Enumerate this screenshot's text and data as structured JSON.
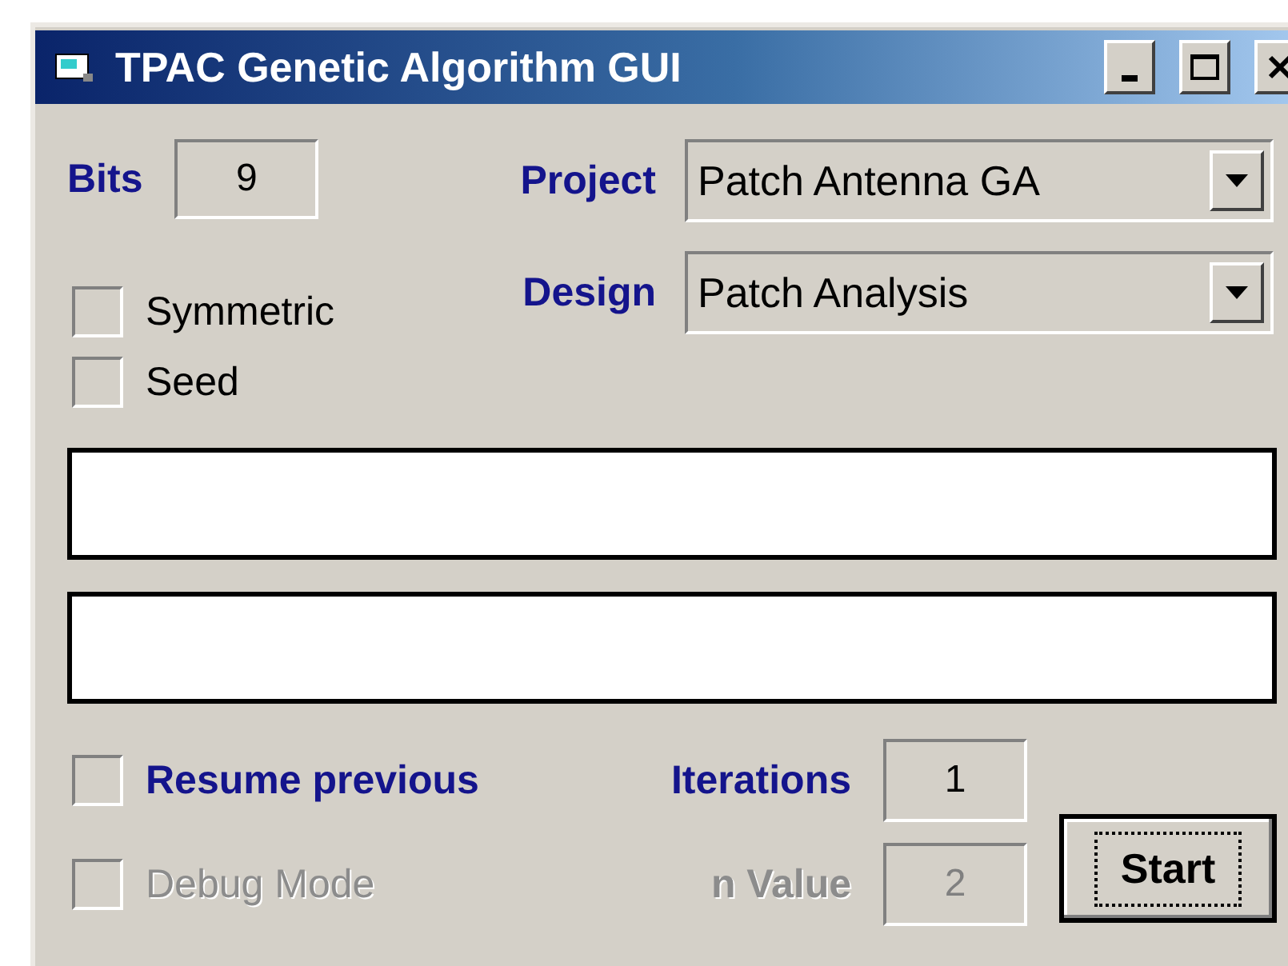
{
  "window": {
    "title": "TPAC Genetic Algorithm GUI"
  },
  "bits": {
    "label": "Bits",
    "value": "9"
  },
  "selectors": [
    {
      "label": "Project",
      "value": "Patch Antenna GA"
    },
    {
      "label": "Design",
      "value": "Patch Analysis"
    }
  ],
  "options": [
    {
      "label": "Symmetric",
      "checked": false
    },
    {
      "label": "Seed",
      "checked": false
    }
  ],
  "bottom_rows": [
    {
      "check_label": "Resume previous",
      "checked": false,
      "check_disabled": false,
      "param_label": "Iterations",
      "param_value": "1",
      "param_disabled": false
    },
    {
      "check_label": "Debug Mode",
      "checked": false,
      "check_disabled": true,
      "param_label": "n Value",
      "param_value": "2",
      "param_disabled": true
    }
  ],
  "start_button": {
    "label": "Start",
    "focused": true
  }
}
